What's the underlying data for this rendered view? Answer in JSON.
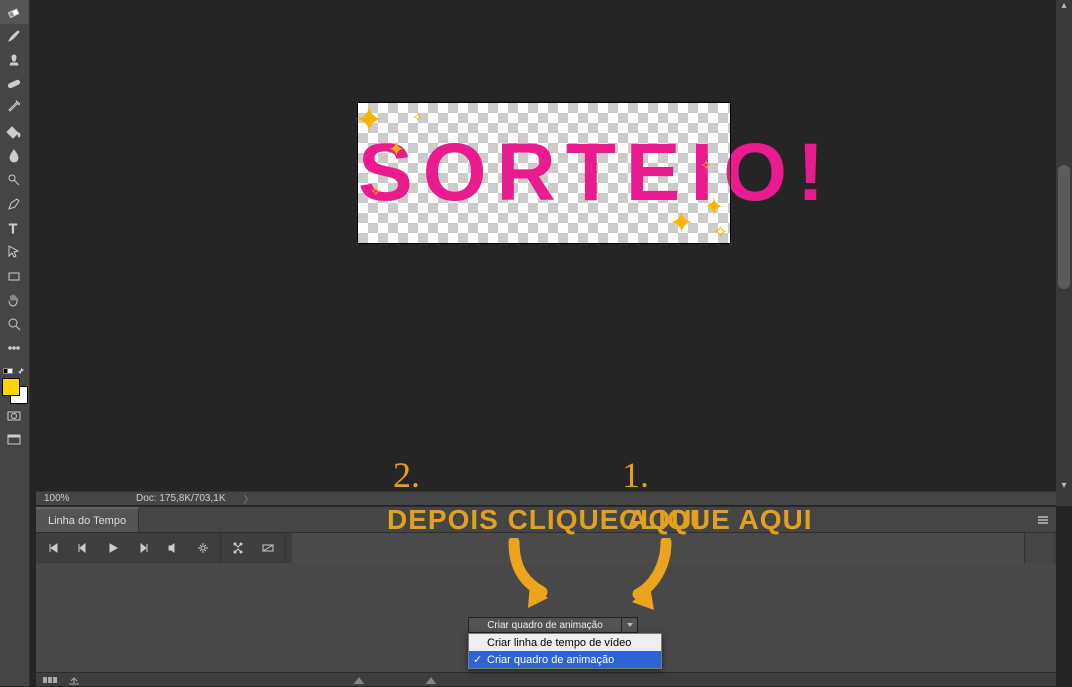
{
  "canvas": {
    "text": "SORTEIO!"
  },
  "statusbar": {
    "zoom": "100%",
    "doc": "Doc: 175,8K/703,1K",
    "chev": "〉"
  },
  "timeline": {
    "tab_label": "Linha do Tempo",
    "create_button": "Criar quadro de animação",
    "menu": {
      "video": "Criar linha de tempo de vídeo",
      "frame": "Criar quadro de animação"
    }
  },
  "annotation": {
    "n1": "1.",
    "n2": "2.",
    "t1": "Clique aqui",
    "t2": "Depois clique aqui"
  }
}
